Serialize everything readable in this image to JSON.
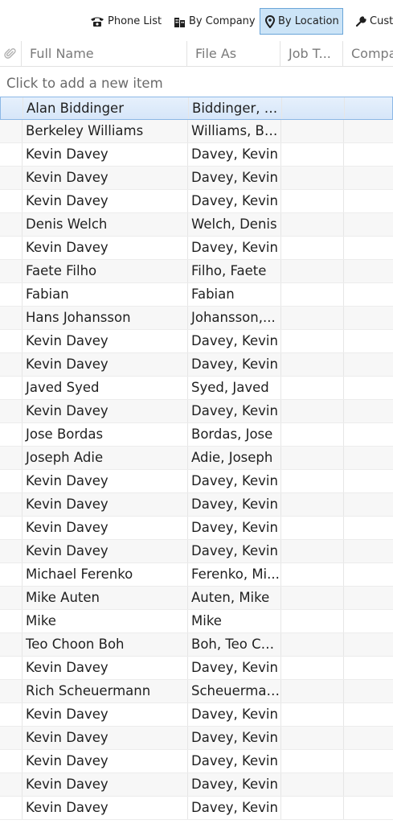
{
  "toolbar": {
    "views": [
      {
        "label": "Phone List",
        "icon": "phone-icon",
        "active": false
      },
      {
        "label": "By Company",
        "icon": "building-icon",
        "active": false
      },
      {
        "label": "By Location",
        "icon": "location-pin-icon",
        "active": true
      },
      {
        "label": "Custo",
        "icon": "wrench-icon",
        "active": false
      }
    ]
  },
  "columns": [
    {
      "key": "attachment",
      "label": "",
      "icon": "paperclip-icon"
    },
    {
      "key": "full_name",
      "label": "Full Name"
    },
    {
      "key": "file_as",
      "label": "File As"
    },
    {
      "key": "job_title",
      "label": "Job T..."
    },
    {
      "key": "company",
      "label": "Compa"
    }
  ],
  "new_item_placeholder": "Click to add a new item",
  "selected_row": 0,
  "rows": [
    {
      "full_name": "Alan Biddinger",
      "file_as": "Biddinger, A..."
    },
    {
      "full_name": "Berkeley Williams",
      "file_as": "Williams, Be..."
    },
    {
      "full_name": "Kevin Davey",
      "file_as": "Davey, Kevin"
    },
    {
      "full_name": "Kevin Davey",
      "file_as": "Davey, Kevin"
    },
    {
      "full_name": "Kevin Davey",
      "file_as": "Davey, Kevin"
    },
    {
      "full_name": "Denis Welch",
      "file_as": "Welch, Denis"
    },
    {
      "full_name": "Kevin Davey",
      "file_as": "Davey, Kevin"
    },
    {
      "full_name": "Faete Filho",
      "file_as": "Filho, Faete"
    },
    {
      "full_name": "Fabian",
      "file_as": "Fabian"
    },
    {
      "full_name": "Hans Johansson",
      "file_as": "Johansson,..."
    },
    {
      "full_name": "Kevin Davey",
      "file_as": "Davey, Kevin"
    },
    {
      "full_name": "Kevin Davey",
      "file_as": "Davey, Kevin"
    },
    {
      "full_name": "Javed Syed",
      "file_as": "Syed, Javed"
    },
    {
      "full_name": "Kevin Davey",
      "file_as": "Davey, Kevin"
    },
    {
      "full_name": "Jose Bordas",
      "file_as": "Bordas, Jose"
    },
    {
      "full_name": "Joseph Adie",
      "file_as": "Adie, Joseph"
    },
    {
      "full_name": "Kevin Davey",
      "file_as": "Davey, Kevin"
    },
    {
      "full_name": "Kevin Davey",
      "file_as": "Davey, Kevin"
    },
    {
      "full_name": "Kevin Davey",
      "file_as": "Davey, Kevin"
    },
    {
      "full_name": "Kevin Davey",
      "file_as": "Davey, Kevin"
    },
    {
      "full_name": "Michael Ferenko",
      "file_as": "Ferenko, Mi..."
    },
    {
      "full_name": "Mike Auten",
      "file_as": "Auten, Mike"
    },
    {
      "full_name": "Mike",
      "file_as": "Mike"
    },
    {
      "full_name": "Teo Choon Boh",
      "file_as": "Boh, Teo Ch..."
    },
    {
      "full_name": "Kevin Davey",
      "file_as": "Davey, Kevin"
    },
    {
      "full_name": "Rich Scheuermann",
      "file_as": "Scheuerman..."
    },
    {
      "full_name": "Kevin Davey",
      "file_as": "Davey, Kevin"
    },
    {
      "full_name": "Kevin Davey",
      "file_as": "Davey, Kevin"
    },
    {
      "full_name": "Kevin Davey",
      "file_as": "Davey, Kevin"
    },
    {
      "full_name": "Kevin Davey",
      "file_as": "Davey, Kevin"
    },
    {
      "full_name": "Kevin Davey",
      "file_as": "Davey, Kevin"
    }
  ]
}
